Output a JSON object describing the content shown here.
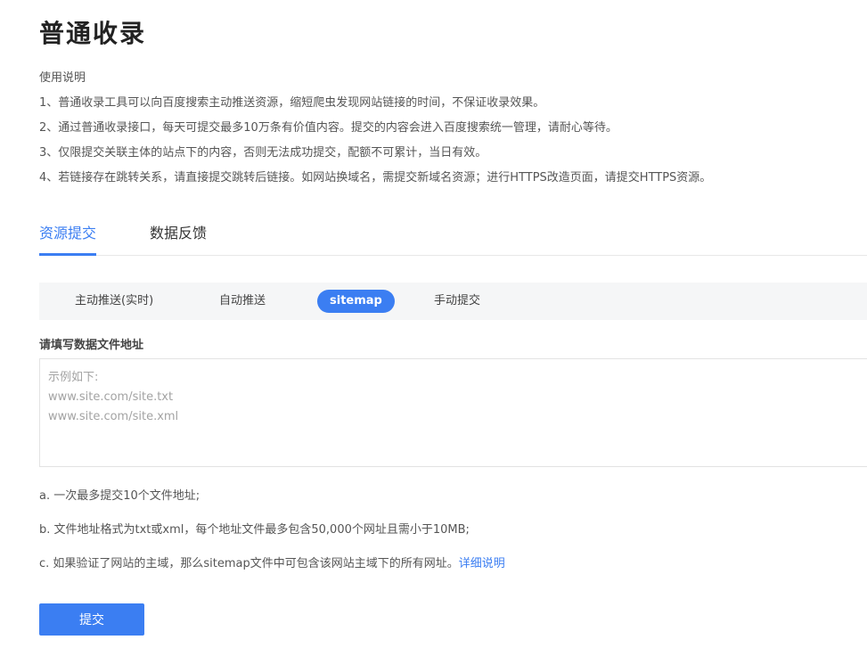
{
  "header": {
    "title": "普通收录"
  },
  "instructions": {
    "heading": "使用说明",
    "items": [
      "1、普通收录工具可以向百度搜索主动推送资源，缩短爬虫发现网站链接的时间，不保证收录效果。",
      "2、通过普通收录接口，每天可提交最多10万条有价值内容。提交的内容会进入百度搜索统一管理，请耐心等待。",
      "3、仅限提交关联主体的站点下的内容，否则无法成功提交，配额不可累计，当日有效。",
      "4、若链接存在跳转关系，请直接提交跳转后链接。如网站换域名，需提交新域名资源；进行HTTPS改造页面，请提交HTTPS资源。"
    ]
  },
  "tabs": [
    {
      "label": "资源提交",
      "active": true
    },
    {
      "label": "数据反馈",
      "active": false
    }
  ],
  "subnav": [
    {
      "label": "主动推送(实时)",
      "active": false
    },
    {
      "label": "自动推送",
      "active": false
    },
    {
      "label": "sitemap",
      "active": true
    },
    {
      "label": "手动提交",
      "active": false
    }
  ],
  "form": {
    "label": "请填写数据文件地址",
    "value": "",
    "placeholder": "示例如下:\nwww.site.com/site.txt\nwww.site.com/site.xml"
  },
  "notes": {
    "a": "a. 一次最多提交10个文件地址;",
    "b": "b. 文件地址格式为txt或xml，每个地址文件最多包含50,000个网址且需小于10MB;",
    "c": "c. 如果验证了网站的主域，那么sitemap文件中可包含该网站主域下的所有网址。",
    "link": "详细说明"
  },
  "submit_label": "提交",
  "colors": {
    "accent": "#3b7ef2",
    "subnav_bg": "#f5f6f7",
    "border": "#e3e3e3"
  }
}
